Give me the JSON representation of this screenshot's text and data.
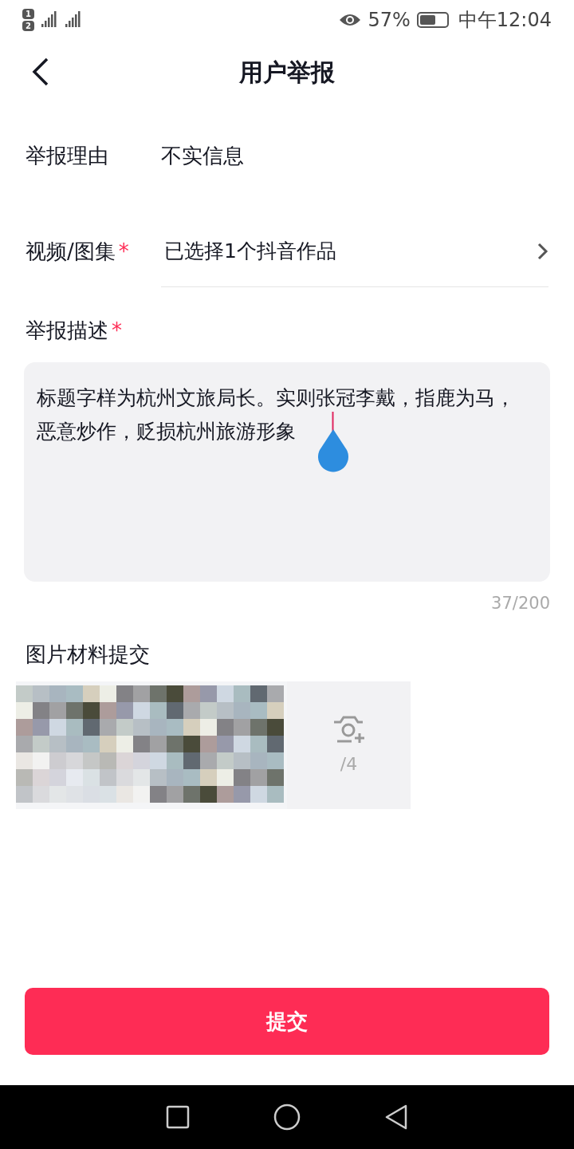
{
  "status_bar": {
    "sim_labels": [
      "1",
      "2"
    ],
    "battery_percent": "57%",
    "time": "中午12:04"
  },
  "header": {
    "title": "用户举报"
  },
  "required_mark": "*",
  "fields": [
    {
      "kind": "static",
      "label": "举报理由",
      "required": false,
      "value": "不实信息"
    },
    {
      "kind": "select",
      "label": "视频/图集",
      "required": true,
      "value": "已选择1个抖音作品"
    }
  ],
  "description": {
    "label": "举报描述",
    "required": true,
    "value": "标题字样为杭州文旅局长。实则张冠李戴，指鹿为马，恶意炒作，贬损杭州旅游形象",
    "counter": "37/200"
  },
  "materials": {
    "label": "图片材料提交",
    "add_count": "/4"
  },
  "submit": {
    "label": "提交"
  }
}
